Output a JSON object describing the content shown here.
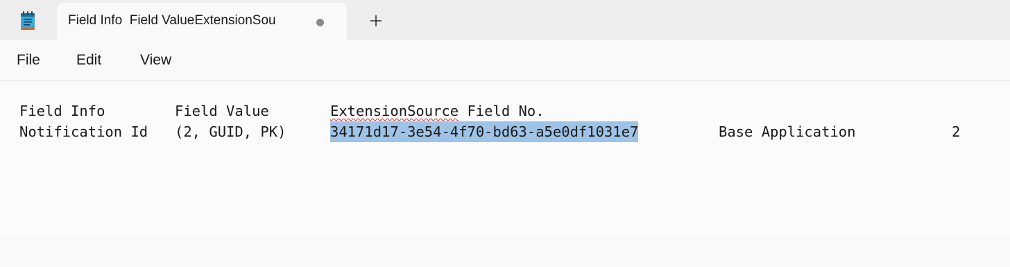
{
  "tab": {
    "title": "Field Info\tField ValueExtensionSou",
    "title_display": "Field Info  Field ValueExtensionSou",
    "unsaved": true
  },
  "new_tab_label": "+",
  "menu": {
    "items": [
      "File",
      "Edit",
      "View"
    ]
  },
  "document": {
    "header": {
      "col1": "Field Info",
      "col2": "Field Value",
      "col3_word1": "ExtensionSource",
      "col3_word2": " Field No."
    },
    "row1": {
      "col1": "Notification Id",
      "col2": "(2, GUID, PK)",
      "col3": "34171d17-3e54-4f70-bd63-a5e0df1031e7",
      "col4": "Base Application",
      "col5": "2"
    }
  },
  "colors": {
    "selection": "#9ec3e6",
    "spellcheck": "#e0242b",
    "titlebar": "#ededed"
  },
  "icons": [
    "notepad-app-icon",
    "unsaved-dot-icon",
    "plus-icon"
  ]
}
